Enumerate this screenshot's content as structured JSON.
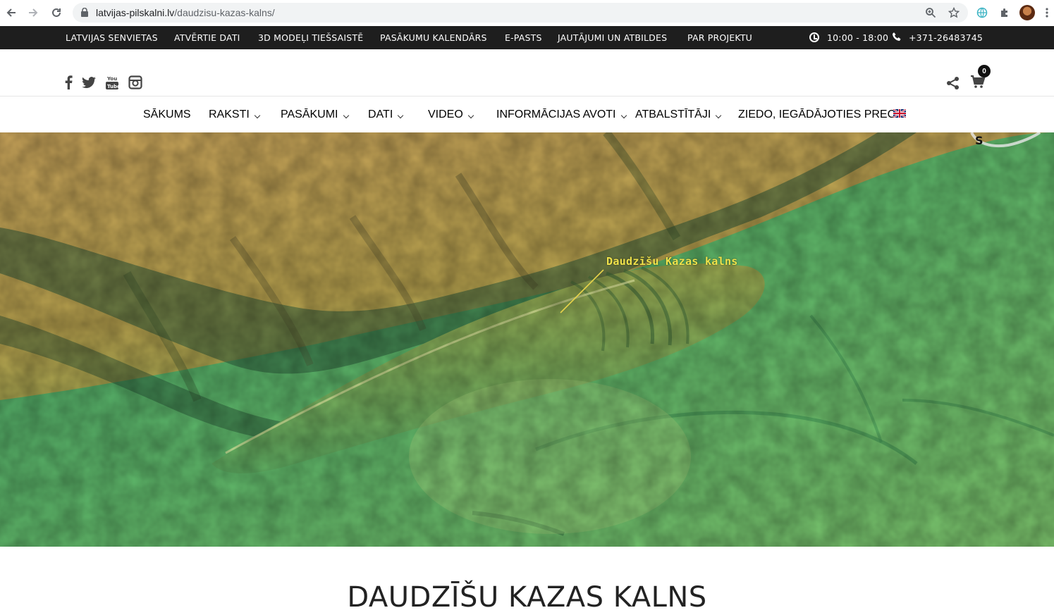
{
  "browser": {
    "url_domain": "latvijas-pilskalni.lv",
    "url_path": "/daudzisu-kazas-kalns/"
  },
  "topbar": {
    "links": [
      "LATVIJAS SENVIETAS",
      "ATVĒRTIE DATI",
      "3D MODEĻI TIEŠSAISTĒ",
      "PASĀKUMU KALENDĀRS",
      "E-PASTS",
      "JAUTĀJUMI UN ATBILDES",
      "PAR PROJEKTU"
    ],
    "hours": "10:00 - 18:00",
    "phone": "+371-26483745"
  },
  "social": {
    "icons": [
      "facebook-icon",
      "twitter-icon",
      "youtube-icon",
      "instagram-icon"
    ],
    "cart_count": "0"
  },
  "mainnav": {
    "items": [
      {
        "label": "SĀKUMS",
        "dropdown": false
      },
      {
        "label": "RAKSTI",
        "dropdown": true
      },
      {
        "label": "PASĀKUMI",
        "dropdown": true
      },
      {
        "label": "DATI",
        "dropdown": true
      },
      {
        "label": "VIDEO",
        "dropdown": true
      },
      {
        "label": "INFORMĀCIJAS AVOTI",
        "dropdown": true
      },
      {
        "label": "ATBALSTĪTĀJI",
        "dropdown": true
      },
      {
        "label": "ZIEDO, IEGĀDĀJOTIES PRECI",
        "dropdown": false
      }
    ],
    "language_flag": "uk-flag-icon"
  },
  "hero": {
    "annotation": "Daudzīšu Kazas kalns",
    "colors": {
      "highland": "#c9a45a",
      "lowland": "#5fb86a",
      "ridge": "#2c5a3a"
    }
  },
  "page": {
    "title": "DAUDZĪŠU KAZAS KALNS"
  }
}
